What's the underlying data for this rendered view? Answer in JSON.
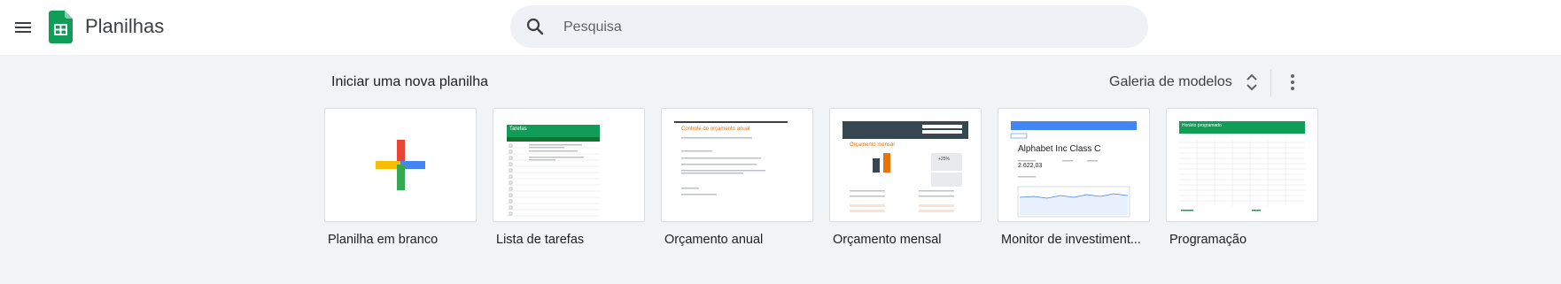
{
  "header": {
    "app_title": "Planilhas",
    "search_placeholder": "Pesquisa"
  },
  "templates": {
    "section_title": "Iniciar uma nova planilha",
    "gallery_label": "Galeria de modelos",
    "items": [
      {
        "label": "Planilha em branco"
      },
      {
        "label": "Lista de tarefas"
      },
      {
        "label": "Orçamento anual"
      },
      {
        "label": "Orçamento mensal"
      },
      {
        "label": "Monitor de investiment..."
      },
      {
        "label": "Programação"
      }
    ]
  },
  "thumbs": {
    "tasks_title": "Tarefas",
    "annual_title": "Controle do orçamento anual",
    "monthly_title": "Orçamento mensal",
    "monthly_pct": "+25%",
    "monitor_title": "Alphabet Inc Class C",
    "monitor_price": "2.622,03",
    "schedule_title": "Horário programado"
  },
  "colors": {
    "sheets_green": "#0f9d58",
    "annual_accent": "#e8710a",
    "monitor_blue": "#4285f4"
  }
}
